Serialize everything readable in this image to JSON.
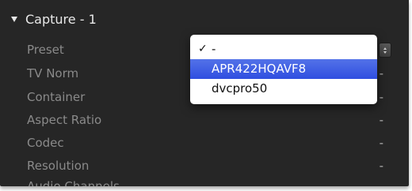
{
  "section": {
    "title": "Capture - 1",
    "expanded": true
  },
  "rows": [
    {
      "label": "Preset",
      "value": ""
    },
    {
      "label": "TV Norm",
      "value": "-"
    },
    {
      "label": "Container",
      "value": "-"
    },
    {
      "label": "Aspect Ratio",
      "value": "-"
    },
    {
      "label": "Codec",
      "value": "-"
    },
    {
      "label": "Resolution",
      "value": "-"
    },
    {
      "label": "Audio Channels",
      "value": ""
    }
  ],
  "preset_menu": {
    "selected_index": 0,
    "highlighted_index": 1,
    "check_glyph": "✓",
    "items": [
      {
        "label": "-"
      },
      {
        "label": "APR422HQAVF8"
      },
      {
        "label": "dvcpro50"
      }
    ]
  },
  "colors": {
    "panel_background": "#262626",
    "highlight": "#3a5ae4",
    "label_text": "#8a8a8a"
  }
}
